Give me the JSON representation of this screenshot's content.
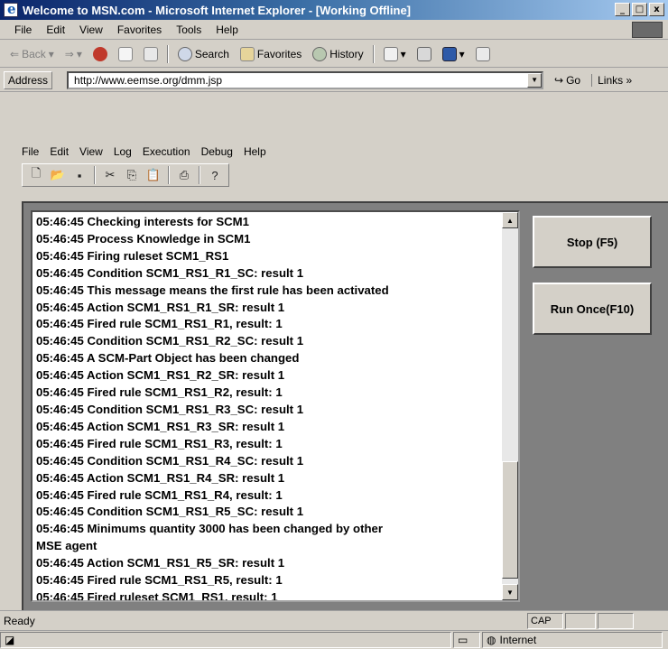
{
  "window": {
    "title": "Welcome to MSN.com - Microsoft Internet Explorer - [Working Offline]",
    "minimize": "_",
    "maximize": "□",
    "close": "x"
  },
  "ie_menu": [
    "File",
    "Edit",
    "View",
    "Favorites",
    "Tools",
    "Help"
  ],
  "ie_toolbar": {
    "back": "Back",
    "search": "Search",
    "favorites": "Favorites",
    "history": "History"
  },
  "address": {
    "label": "Address",
    "url": "http://www.eemse.org/dmm.jsp",
    "go": "Go",
    "links": "Links »"
  },
  "app_menu": [
    "File",
    "Edit",
    "View",
    "Log",
    "Execution",
    "Debug",
    "Help"
  ],
  "app_toolbar_icons": [
    "new-icon",
    "open-icon",
    "save-icon",
    "cut-icon",
    "copy-icon",
    "paste-icon",
    "print-icon",
    "help-icon"
  ],
  "log": [
    "05:46:45 Checking interests for SCM1",
    "05:46:45 Process Knowledge in SCM1",
    "05:46:45 Firing ruleset SCM1_RS1",
    "05:46:45 Condition SCM1_RS1_R1_SC: result 1",
    "05:46:45 This message means the first rule has been activated",
    "05:46:45 Action SCM1_RS1_R1_SR: result 1",
    "05:46:45 Fired rule SCM1_RS1_R1, result: 1",
    "05:46:45 Condition SCM1_RS1_R2_SC: result 1",
    "05:46:45 A   SCM-Part    Object has been changed",
    "05:46:45 Action SCM1_RS1_R2_SR: result 1",
    "05:46:45 Fired rule SCM1_RS1_R2, result: 1",
    "05:46:45 Condition SCM1_RS1_R3_SC: result 1",
    "05:46:45 Action SCM1_RS1_R3_SR: result 1",
    "05:46:45 Fired rule SCM1_RS1_R3, result: 1",
    "05:46:45 Condition SCM1_RS1_R4_SC: result 1",
    "05:46:45 Action SCM1_RS1_R4_SR: result 1",
    "05:46:45 Fired rule SCM1_RS1_R4, result: 1",
    "05:46:45 Condition SCM1_RS1_R5_SC: result 1",
    "05:46:45 Minimums quantity 3000 has been changed by other",
    "MSE agent",
    "05:46:45 Action SCM1_RS1_R5_SR: result 1",
    "05:46:45 Fired rule SCM1_RS1_R5, result: 1",
    "05:46:45 Fired ruleset SCM1_RS1, result: 1"
  ],
  "buttons": {
    "stop": "Stop (F5)",
    "run_once": "Run Once(F10)"
  },
  "status": {
    "text": "Ready",
    "cap": "CAP",
    "zone": "Internet"
  }
}
